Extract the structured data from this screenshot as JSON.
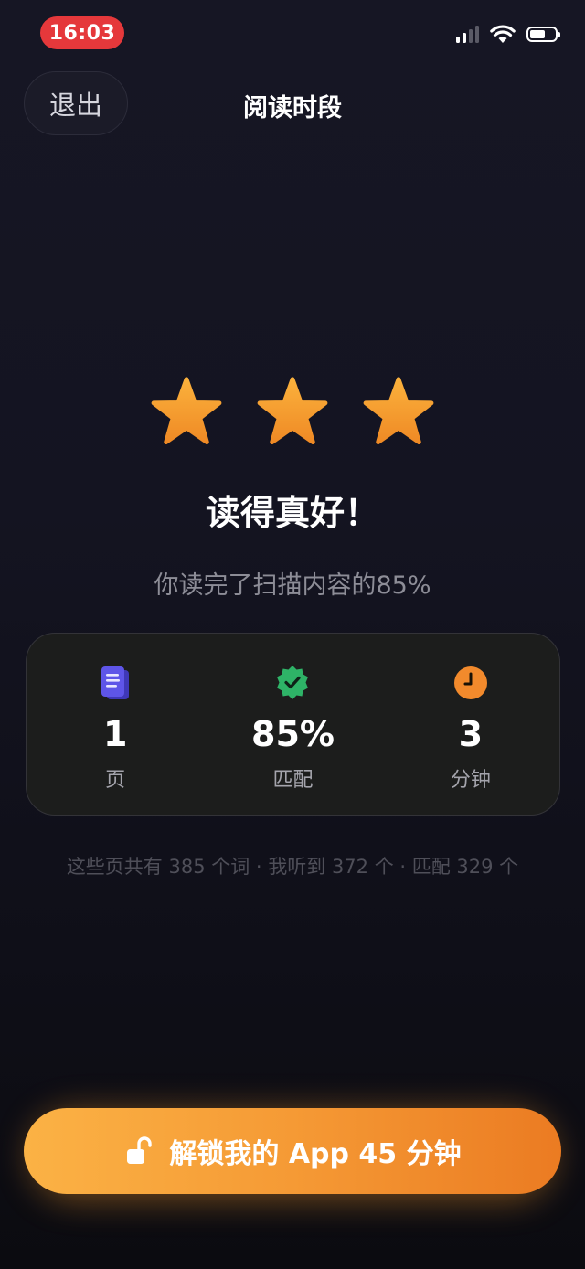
{
  "status_bar": {
    "time": "16:03",
    "icons": [
      "cellular-signal-icon",
      "wifi-icon",
      "battery-icon"
    ]
  },
  "header": {
    "exit_label": "退出",
    "title": "阅读时段"
  },
  "result": {
    "stars_earned": 3,
    "stars_total": 3,
    "headline": "读得真好！",
    "subline": "你读完了扫描内容的85%"
  },
  "stats": [
    {
      "icon": "document-icon",
      "value": "1",
      "label": "页",
      "color": "#5e55e8"
    },
    {
      "icon": "verified-check-icon",
      "value": "85%",
      "label": "匹配",
      "color": "#2eb367"
    },
    {
      "icon": "clock-icon",
      "value": "3",
      "label": "分钟",
      "color": "#f28a2c"
    }
  ],
  "footnote": "这些页共有 385 个词 · 我听到 372 个 · 匹配 329 个",
  "cta": {
    "icon": "unlock-icon",
    "label": "解锁我的 App 45 分钟"
  },
  "colors": {
    "background": "#141421",
    "accent": "#f59a35",
    "star": "#f7a033",
    "time_pill": "#e5383b"
  }
}
